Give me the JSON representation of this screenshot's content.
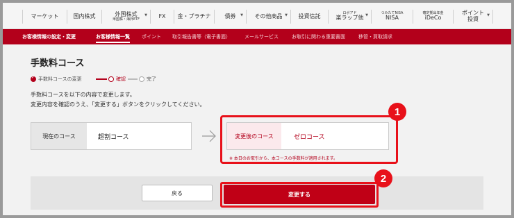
{
  "topnav": {
    "items": [
      {
        "label": "マーケット",
        "sub": ""
      },
      {
        "label": "国内株式",
        "sub": ""
      },
      {
        "label": "外国株式",
        "sub": "米国株・海外ETF"
      },
      {
        "label": "FX",
        "sub": ""
      },
      {
        "label": "金・プラチナ",
        "sub": ""
      },
      {
        "label": "債券",
        "sub": ""
      },
      {
        "label": "その他商品",
        "sub": ""
      },
      {
        "label": "投資信託",
        "sub": ""
      },
      {
        "label": "ロボアド",
        "sub": "楽ラップ他"
      },
      {
        "label": "つみたてNISA",
        "sub": "NISA"
      },
      {
        "label": "確定拠出年金",
        "sub": "iDeCo"
      },
      {
        "label": "ポイント",
        "sub": "投資"
      }
    ]
  },
  "subnav": {
    "items": [
      {
        "label": "お客様情報の設定・変更"
      },
      {
        "label": "お客様情報一覧"
      },
      {
        "label": "ポイント"
      },
      {
        "label": "取引報告書等（電子書面）"
      },
      {
        "label": "メールサービス"
      },
      {
        "label": "お取引に関わる重要書面"
      },
      {
        "label": "移管・買取請求"
      }
    ]
  },
  "page": {
    "title": "手数料コース",
    "steps": [
      "手数料コースの変更",
      "確認",
      "完了"
    ],
    "desc_line1": "手数料コースを以下の内容で変更します。",
    "desc_line2": "変更内容を確認のうえ、「変更する」ボタンをクリックしてください。",
    "current_label": "現在のコース",
    "current_value": "超割コース",
    "new_label": "変更後のコース",
    "new_value": "ゼロコース",
    "note": "※ 本日のお取引から、本コースの手数料が適用されます。",
    "back_button": "戻る",
    "change_button": "変更する"
  },
  "annotations": {
    "badge1": "1",
    "badge2": "2"
  },
  "colors": {
    "brand": "#b3001b",
    "highlight": "#e8111a"
  }
}
